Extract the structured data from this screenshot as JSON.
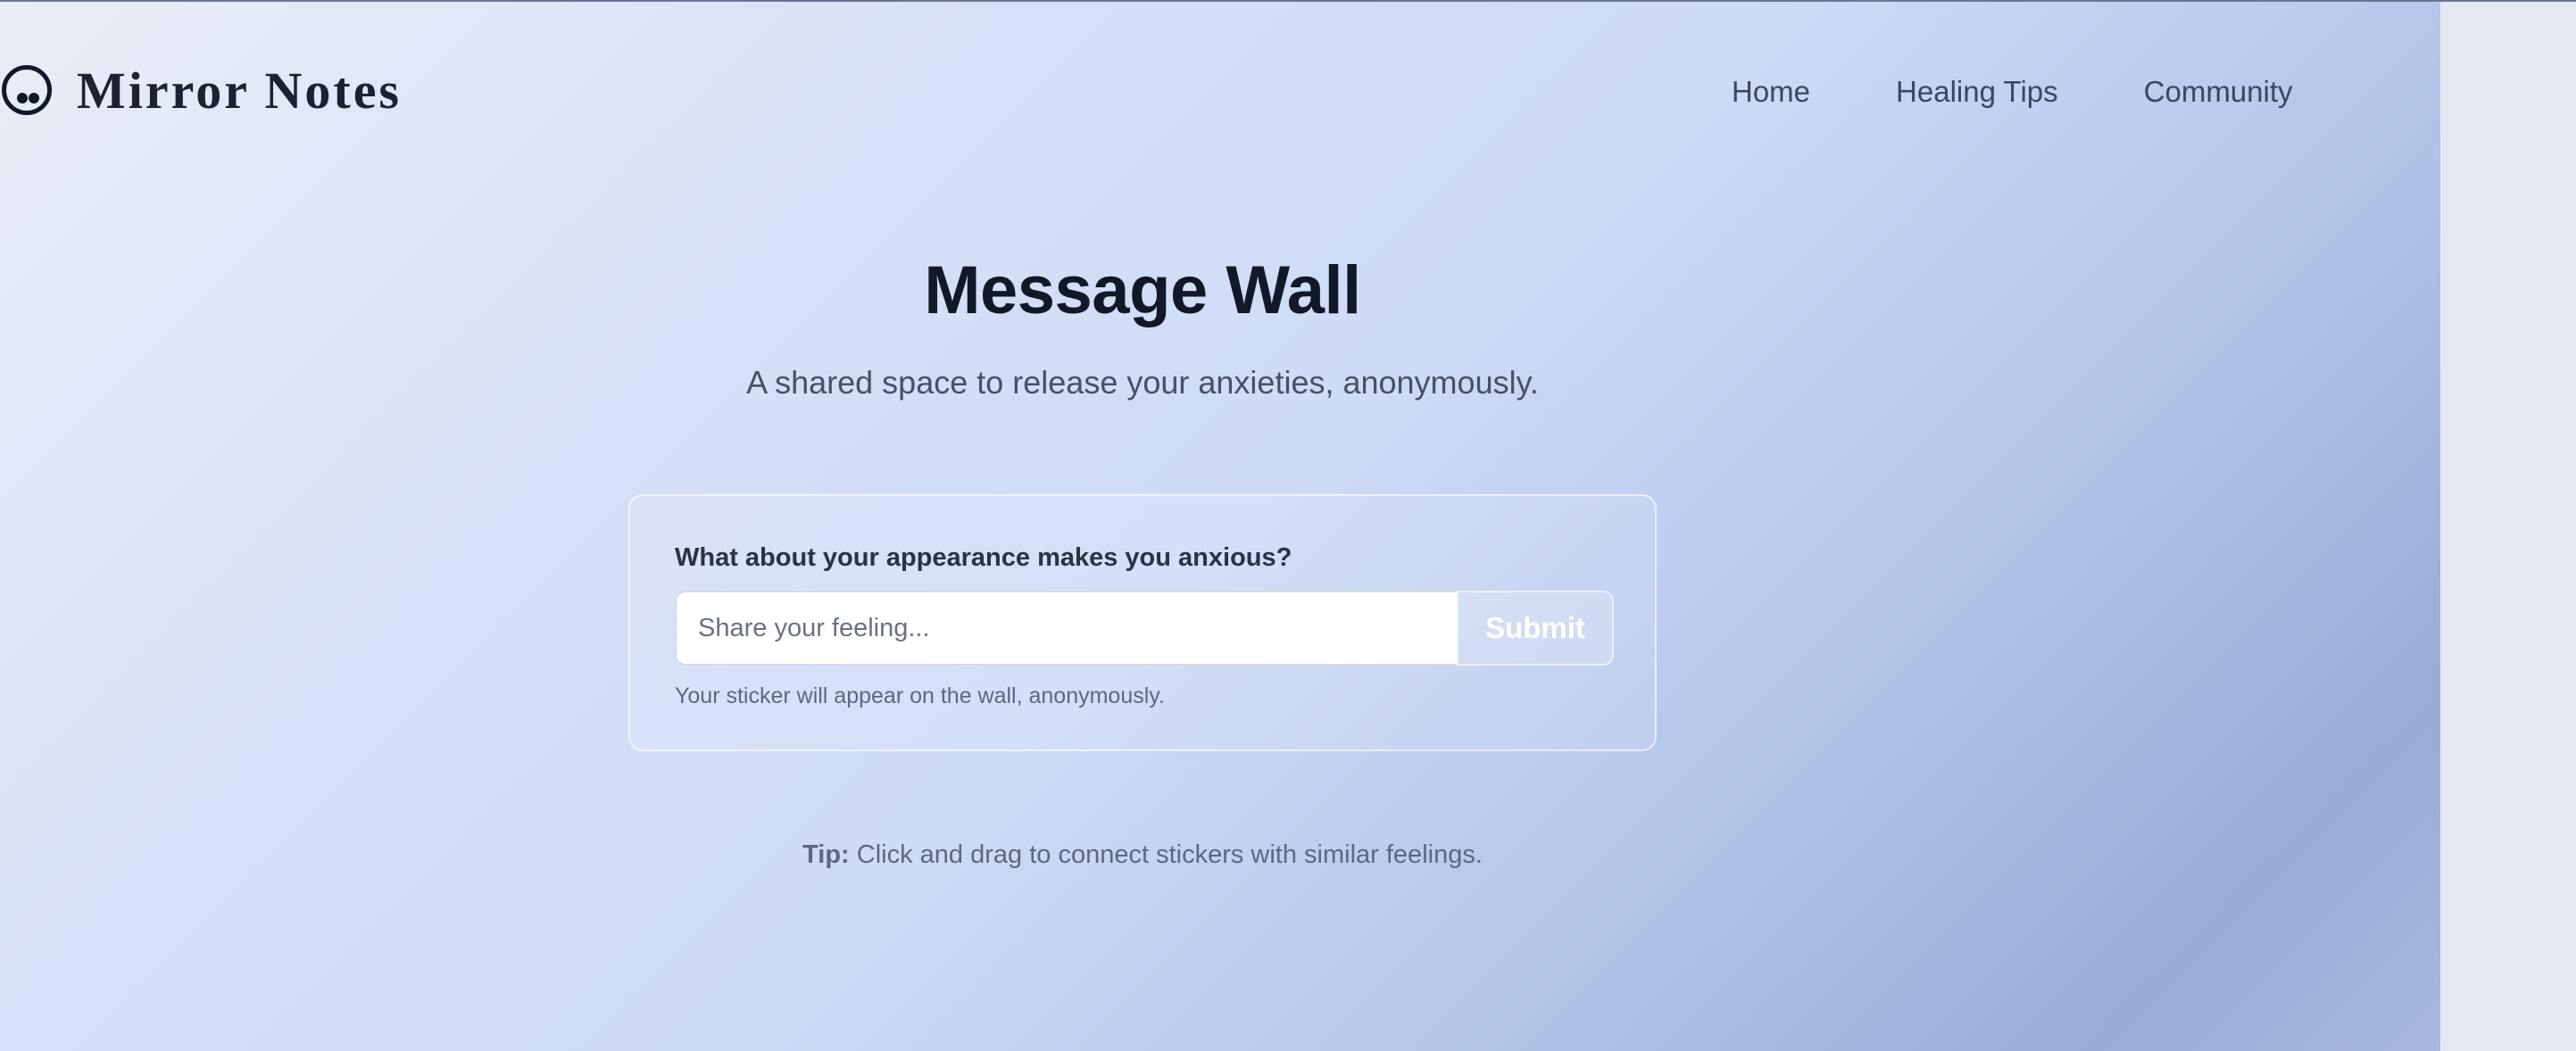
{
  "brand": {
    "name": "Mirror Notes",
    "icon": "face-circle-icon"
  },
  "nav": {
    "items": [
      {
        "label": "Home"
      },
      {
        "label": "Healing Tips"
      },
      {
        "label": "Community"
      }
    ]
  },
  "hero": {
    "title": "Message Wall",
    "subtitle": "A shared space to release your anxieties, anonymously."
  },
  "form": {
    "label": "What about your appearance makes you anxious?",
    "input_value": "",
    "input_placeholder": "Share your feeling...",
    "submit_label": "Submit",
    "note": "Your sticker will appear on the wall, anonymously."
  },
  "tip": {
    "prefix": "Tip:",
    "text": " Click and drag to connect stickers with similar feelings."
  },
  "colors": {
    "text_dark": "#111827",
    "text_muted": "#5e6780",
    "gradient_start": "#e9edf6",
    "gradient_end": "#98acd6"
  }
}
